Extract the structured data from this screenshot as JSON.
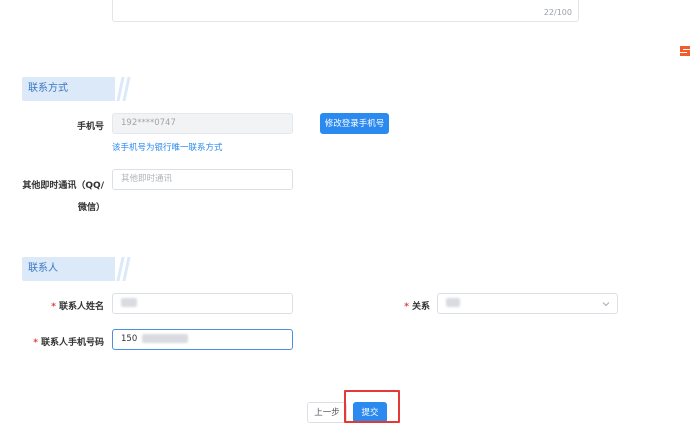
{
  "description_box": {
    "char_count": "22/100"
  },
  "logo": {
    "icon": "brand-s-icon",
    "color": "#f25c2a"
  },
  "contact_method_section": {
    "title": "联系方式",
    "phone": {
      "label": "手机号",
      "value": "192****0747",
      "change_button": "修改登录手机号",
      "hint": "该手机号为银行唯一联系方式"
    },
    "im": {
      "label_line1": "其他即时通讯（QQ/",
      "label_line2": "微信）",
      "placeholder": "其他即时通讯"
    }
  },
  "contact_person_section": {
    "title": "联系人",
    "name": {
      "label": "联系人姓名",
      "required_mark": "*"
    },
    "relation": {
      "label": "关系",
      "required_mark": "*"
    },
    "phone": {
      "label": "联系人手机号码",
      "required_mark": "*",
      "value_prefix": "150"
    }
  },
  "actions": {
    "prev_label": "上一步",
    "submit_label": "提交"
  },
  "colors": {
    "primary": "#2a8af0",
    "section_bg": "#dbe9f8",
    "section_text": "#3a76c4",
    "required": "#e2423b",
    "highlight": "#e53935"
  }
}
